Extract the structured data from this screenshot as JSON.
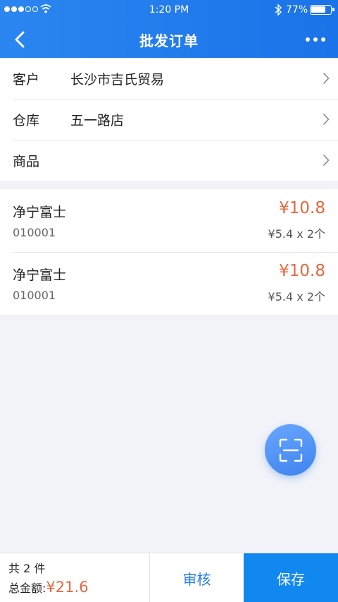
{
  "status_bar": {
    "time": "1:20 PM",
    "battery": "77%",
    "battery_level": 0.77
  },
  "nav": {
    "title": "批发订单",
    "back_icon": "chevron-left-icon",
    "more_icon": "more-horizontal-icon"
  },
  "form": {
    "rows": [
      {
        "label": "客户",
        "value": "长沙市吉氏贸易"
      },
      {
        "label": "仓库",
        "value": "五一路店"
      },
      {
        "label": "商品",
        "value": ""
      }
    ]
  },
  "items": [
    {
      "name": "净宁富士",
      "code": "010001",
      "price": "¥10.8",
      "qty": "¥5.4 x 2个"
    },
    {
      "name": "净宁富士",
      "code": "010001",
      "price": "¥10.8",
      "qty": "¥5.4 x 2个"
    }
  ],
  "scan_button": {
    "icon": "scan-icon"
  },
  "footer": {
    "count": "共 2 件",
    "total_label": "总金额:",
    "total_value": "¥21.6",
    "audit_label": "审核",
    "save_label": "保存"
  },
  "colors": {
    "brand": "#1a73e8",
    "price": "#e8663d",
    "save_button": "#1188f0"
  }
}
